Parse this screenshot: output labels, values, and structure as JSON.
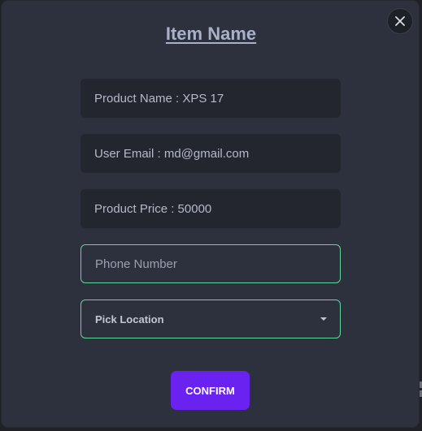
{
  "modal": {
    "title": "Item Name",
    "close_icon": "close-icon"
  },
  "fields": {
    "product_name": "Product Name : XPS 17",
    "user_email": "User Email : md@gmail.com",
    "product_price": "Product Price : 50000",
    "phone_placeholder": "Phone Number",
    "location_label": "Pick Location"
  },
  "actions": {
    "confirm_label": "CONFIRM"
  },
  "colors": {
    "modal_bg": "#2d313d",
    "field_bg": "#23262f",
    "accent_border": "#5fd69a",
    "confirm_bg": "#6922f0",
    "title": "#a9b0c8"
  }
}
